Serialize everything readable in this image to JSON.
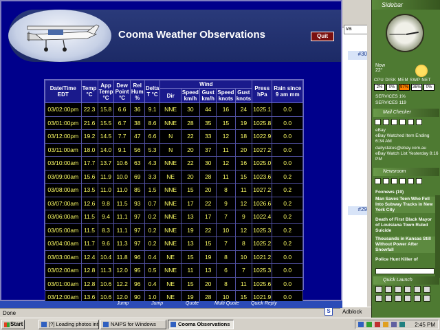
{
  "weather": {
    "title": "Cooma Weather Observations",
    "quit_label": "Quit",
    "headers": {
      "datetime": "Date/Time EDT",
      "temp": "Temp °C",
      "app_temp": "App Temp °C",
      "dew_point": "Dew Point °C",
      "rel_hum": "Rel Hum %",
      "delta_t": "Delta T °C",
      "wind": "Wind",
      "dir": "Dir",
      "speed_kmh": "Speed km/h",
      "gust_kmh": "Gust km/h",
      "speed_knots": "Speed knots",
      "gust_knots": "Gust knots",
      "press": "Press hPa",
      "rain": "Rain since 9 am mm"
    },
    "rows": [
      [
        "03/02:00pm",
        "22.3",
        "15.8",
        "6.6",
        "36",
        "9.1",
        "NNE",
        "30",
        "44",
        "16",
        "24",
        "1025.1",
        "0.0"
      ],
      [
        "03/01:00pm",
        "21.6",
        "15.5",
        "6.7",
        "38",
        "8.6",
        "NNE",
        "28",
        "35",
        "15",
        "19",
        "1025.8",
        "0.0"
      ],
      [
        "03/12:00pm",
        "19.2",
        "14.5",
        "7.7",
        "47",
        "6.6",
        "N",
        "22",
        "33",
        "12",
        "18",
        "1022.9",
        "0.0"
      ],
      [
        "03/11:00am",
        "18.0",
        "14.0",
        "9.1",
        "56",
        "5.3",
        "N",
        "20",
        "37",
        "11",
        "20",
        "1027.2",
        "0.0"
      ],
      [
        "03/10:00am",
        "17.7",
        "13.7",
        "10.6",
        "63",
        "4.3",
        "NNE",
        "22",
        "30",
        "12",
        "16",
        "1025.0",
        "0.0"
      ],
      [
        "03/09:00am",
        "15.6",
        "11.9",
        "10.0",
        "69",
        "3.3",
        "NE",
        "20",
        "28",
        "11",
        "15",
        "1023.6",
        "0.2"
      ],
      [
        "03/08:00am",
        "13.5",
        "11.0",
        "11.0",
        "85",
        "1.5",
        "NNE",
        "15",
        "20",
        "8",
        "11",
        "1027.2",
        "0.2"
      ],
      [
        "03/07:00am",
        "12.6",
        "9.8",
        "11.5",
        "93",
        "0.7",
        "NNE",
        "17",
        "22",
        "9",
        "12",
        "1026.6",
        "0.2"
      ],
      [
        "03/06:00am",
        "11.5",
        "9.4",
        "11.1",
        "97",
        "0.2",
        "NNE",
        "13",
        "17",
        "7",
        "9",
        "1022.4",
        "0.2"
      ],
      [
        "03/05:00am",
        "11.5",
        "8.3",
        "11.1",
        "97",
        "0.2",
        "NNE",
        "19",
        "22",
        "10",
        "12",
        "1025.3",
        "0.2"
      ],
      [
        "03/04:00am",
        "11.7",
        "9.6",
        "11.3",
        "97",
        "0.2",
        "NNE",
        "13",
        "15",
        "7",
        "8",
        "1025.2",
        "0.2"
      ],
      [
        "03/03:00am",
        "12.4",
        "10.4",
        "11.8",
        "96",
        "0.4",
        "NE",
        "15",
        "19",
        "8",
        "10",
        "1021.2",
        "0.0"
      ],
      [
        "03/02:00am",
        "12.8",
        "11.3",
        "12.0",
        "95",
        "0.5",
        "NNE",
        "11",
        "13",
        "6",
        "7",
        "1025.3",
        "0.0"
      ],
      [
        "03/01:00am",
        "12.8",
        "10.6",
        "12.2",
        "96",
        "0.4",
        "NE",
        "15",
        "20",
        "8",
        "11",
        "1025.6",
        "0.0"
      ],
      [
        "03/12:00am",
        "13.6",
        "10.6",
        "12.0",
        "90",
        "1.0",
        "NE",
        "19",
        "28",
        "10",
        "15",
        "1021.9",
        "0.0"
      ]
    ],
    "status_text": "Done",
    "tabs": [
      "Jump",
      "Jump",
      "Quote",
      "Multi Quote",
      "Quick Reply"
    ]
  },
  "background_browser": {
    "address_fragment": "va",
    "post_num_1": "#30",
    "post_num_2": "#29",
    "status": "Adblock"
  },
  "sidebar": {
    "title": "Sidebar",
    "weather_now": "Now",
    "weather_temp": "22°",
    "perf_labels": "CPU DISK MEM SWP NET",
    "perf_values": [
      "2%",
      "0%",
      "97%",
      "36%",
      "0%"
    ],
    "services_1": "SERVICES 1%",
    "services_2": "SERVICES 119",
    "mail_section": "Mail Checker",
    "mail_1_from": "eBay",
    "mail_1_subject": "eBay Watched Item Ending 6:34 AM",
    "mail_2_from": "dailystatus@ebay.com.au",
    "mail_2_subject": "eBay Watch List Yesterday 8:16 PM",
    "news_section": "Newsroom",
    "news_1": "Foxnews (19)",
    "news_2": "Man Saves Teen Who Fell Into Subway Tracks in New York City",
    "news_3": "Death of First Black Mayor of Louisiana Town Ruled Suicide",
    "news_4": "Thousands in Kansas Still Without Power After Snowfall",
    "news_5": "Police Hunt Killer of",
    "quick_launch": "Quick Launch"
  },
  "taskbar": {
    "start": "Start",
    "tasks": [
      "[?] Loading photos int...",
      "NAIPS for Windows",
      "Cooma Observations"
    ],
    "clock": "2:45 PM"
  }
}
